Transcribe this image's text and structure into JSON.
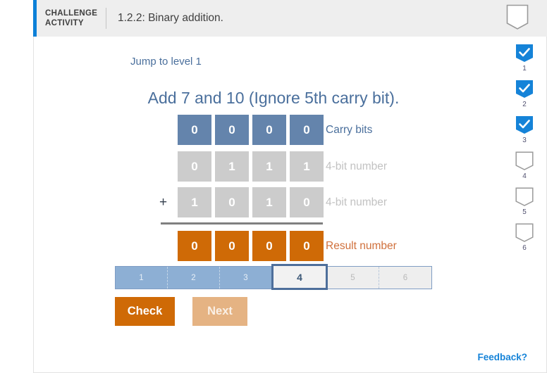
{
  "header": {
    "kicker": "CHALLENGE ACTIVITY",
    "kicker_line1": "CHALLENGE",
    "kicker_line2": "ACTIVITY",
    "title": "1.2.2: Binary addition.",
    "bookmark_icon": "bookmark-ribbon-icon"
  },
  "main": {
    "jump_link": "Jump to level 1",
    "prompt": "Add 7 and 10 (Ignore 5th carry bit).",
    "plus_sign": "+",
    "rows": [
      {
        "id": "carry-bits",
        "kind": "carry",
        "label": "Carry bits",
        "bits": [
          "0",
          "0",
          "0",
          "0"
        ]
      },
      {
        "id": "operand-1",
        "kind": "operand",
        "label": "4-bit number",
        "bits": [
          "0",
          "1",
          "1",
          "1"
        ]
      },
      {
        "id": "operand-2",
        "kind": "operand",
        "label": "4-bit number",
        "bits": [
          "1",
          "0",
          "1",
          "0"
        ]
      },
      {
        "id": "result",
        "kind": "result",
        "label": "Result number",
        "bits": [
          "0",
          "0",
          "0",
          "0"
        ]
      }
    ]
  },
  "steps": {
    "items": [
      {
        "label": "1",
        "state": "done"
      },
      {
        "label": "2",
        "state": "done"
      },
      {
        "label": "3",
        "state": "done"
      },
      {
        "label": "4",
        "state": "current"
      },
      {
        "label": "5",
        "state": "pending"
      },
      {
        "label": "6",
        "state": "pending"
      }
    ]
  },
  "buttons": {
    "check": "Check",
    "next": "Next"
  },
  "rail": {
    "items": [
      {
        "number": "1",
        "checked": true,
        "icon": "bookmark-check-icon"
      },
      {
        "number": "2",
        "checked": true,
        "icon": "bookmark-check-icon"
      },
      {
        "number": "3",
        "checked": true,
        "icon": "bookmark-check-icon"
      },
      {
        "number": "4",
        "checked": false,
        "icon": "bookmark-empty-icon"
      },
      {
        "number": "5",
        "checked": false,
        "icon": "bookmark-empty-icon"
      },
      {
        "number": "6",
        "checked": false,
        "icon": "bookmark-empty-icon"
      }
    ]
  },
  "footer": {
    "feedback": "Feedback?"
  },
  "colors": {
    "accent_blue": "#0d80d8",
    "carry_blue": "#6484ac",
    "operand_gray": "#cccccc",
    "result_orange": "#cf6a06",
    "prompt_blue": "#4a6f9c",
    "step_done": "#8dafd4",
    "step_current_border": "#4e6f9b",
    "next_disabled": "#e5b383",
    "feedback_blue": "#1583d8"
  }
}
